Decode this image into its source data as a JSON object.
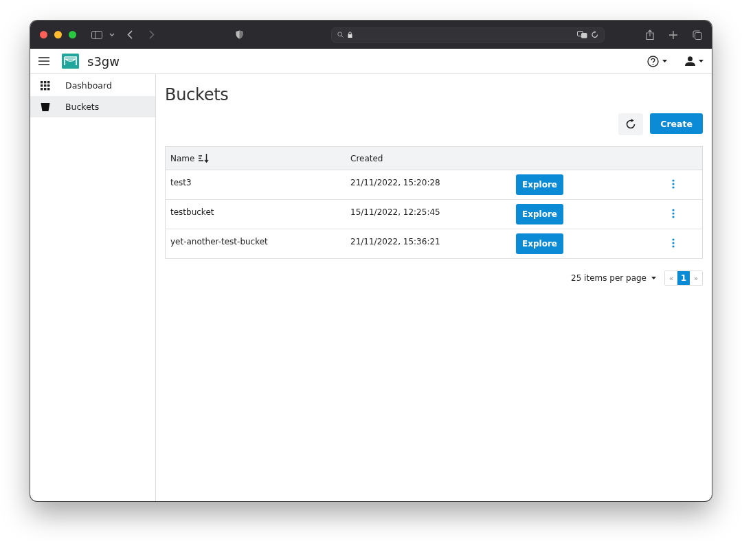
{
  "app": {
    "name": "s3gw"
  },
  "sidebar": {
    "items": [
      {
        "label": "Dashboard",
        "kind": "grid",
        "selected": false
      },
      {
        "label": "Buckets",
        "kind": "bucket",
        "selected": true
      }
    ]
  },
  "page": {
    "title": "Buckets",
    "create_button": "Create"
  },
  "table": {
    "columns": [
      {
        "label": "Name",
        "sorted": true
      },
      {
        "label": "Created",
        "sorted": false
      }
    ],
    "rows": [
      {
        "name": "test3",
        "created": "21/11/2022, 15:20:28",
        "action": "Explore"
      },
      {
        "name": "testbucket",
        "created": "15/11/2022, 12:25:45",
        "action": "Explore"
      },
      {
        "name": "yet-another-test-bucket",
        "created": "21/11/2022, 15:36:21",
        "action": "Explore"
      }
    ]
  },
  "pagination": {
    "page_size": "25 items per page",
    "prev": "«",
    "next": "»",
    "pages": [
      {
        "label": "1",
        "selected": true
      }
    ]
  }
}
